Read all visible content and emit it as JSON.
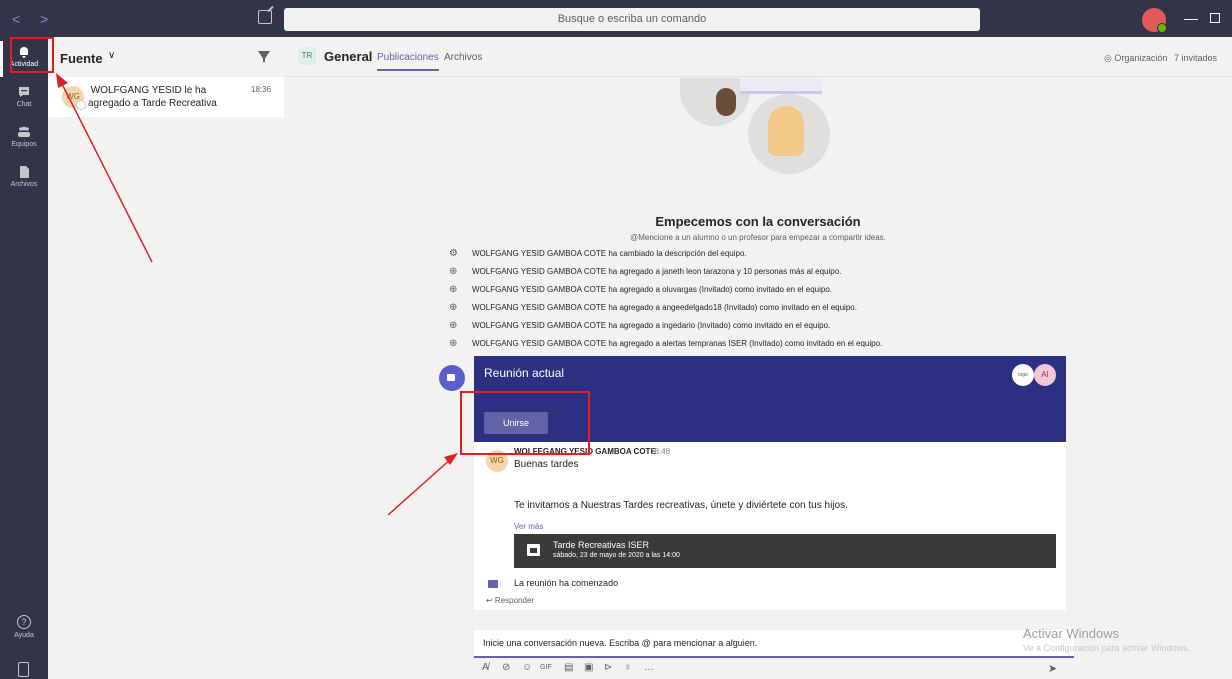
{
  "titlebar": {
    "search_placeholder": "Busque o escriba un comando",
    "nav_arrows": "< >",
    "minimize": "—"
  },
  "appbar": {
    "items": [
      {
        "label": "Actividad",
        "icon": "bell-icon",
        "active": true
      },
      {
        "label": "Chat",
        "icon": "chat-icon",
        "active": false
      },
      {
        "label": "Equipos",
        "icon": "teams-icon",
        "active": false
      },
      {
        "label": "Archivos",
        "icon": "files-icon",
        "active": false
      }
    ],
    "help_label": "Ayuda",
    "help_glyph": "?"
  },
  "activity": {
    "title": "Fuente",
    "chevron": "∨",
    "feed": [
      {
        "avatar": "WG",
        "text": " WOLFGANG YESID le ha agregado a Tarde Recreativa",
        "time": "18:36"
      }
    ]
  },
  "channel": {
    "team_badge": "TR",
    "name": "General",
    "tabs": [
      "Publicaciones",
      "Archivos"
    ],
    "org_label": "◎ Organización",
    "guests_label": "7 invitados"
  },
  "conversation": {
    "empty_title": "Empecemos con la conversación",
    "empty_sub": "@Mencione a un alumno o un profesor para empezar a compartir ideas.",
    "events": [
      {
        "icon": "team-settings-icon",
        "glyph": "⚙",
        "text": "WOLFGANG YESID GAMBOA COTE ha cambiado la descripción del equipo."
      },
      {
        "icon": "add-member-icon",
        "glyph": "⊕",
        "text": "WOLFGANG YESID GAMBOA COTE ha agregado a janeth leon tarazona y 10 personas más al equipo."
      },
      {
        "icon": "add-member-icon",
        "glyph": "⊕",
        "text": "WOLFGANG YESID GAMBOA COTE ha agregado a oluvargas (Invitado) como invitado en el equipo."
      },
      {
        "icon": "add-member-icon",
        "glyph": "⊕",
        "text": "WOLFGANG YESID GAMBOA COTE ha agregado a angeedelgado18 (Invitado) como invitado en el equipo."
      },
      {
        "icon": "add-member-icon",
        "glyph": "⊕",
        "text": "WOLFGANG YESID GAMBOA COTE ha agregado a ingedario (Invitado) como invitado en el equipo."
      },
      {
        "icon": "add-member-icon",
        "glyph": "⊕",
        "text": "WOLFGANG YESID GAMBOA COTE ha agregado a alertas tempranas ISER (Invitado) como invitado en el equipo."
      }
    ],
    "meeting": {
      "title": "Reunión actual",
      "join_label": "Unirse",
      "participant_1": "logo",
      "participant_2": "AI",
      "message": {
        "avatar": "WG",
        "author": "WOLFEGANG YESID GAMBOA COTE",
        "time": "18:48",
        "greeting": "Buenas tardes",
        "body": "Te invitamos a Nuestras Tardes recreativas, únete y diviértete con tus hijos.",
        "see_more": "Ver más"
      },
      "event_card": {
        "title": "Tarde Recreativas ISER",
        "date": "sábado, 23 de mayo de 2020 a las 14:00"
      },
      "started_text": "La reunión ha comenzado",
      "reply_label": "↩ Responder"
    }
  },
  "composer": {
    "placeholder": "Inicie una conversación nueva. Escriba @ para mencionar a alguien.",
    "tools": [
      "A̸",
      "⊘",
      "☺",
      "GIF",
      "▤",
      "▣",
      "⊳",
      "♀",
      "…"
    ],
    "send": "➤"
  },
  "watermark": {
    "title": "Activar Windows",
    "subtitle": "Ve a Configuración para activar Windows."
  },
  "colors": {
    "brand": "#6264a7",
    "rail": "#33344a",
    "meeting_banner": "#2b3180",
    "annotation": "#e02020"
  }
}
